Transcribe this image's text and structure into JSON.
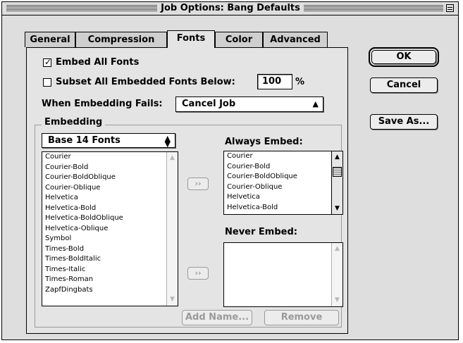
{
  "window": {
    "title": "Job Options: Bang Defaults"
  },
  "icons": {
    "zoom": "zoom-box-icon",
    "checkmark": "check-icon",
    "popup_arrows": "up-down-arrows-icon",
    "move": "move-right-icon"
  },
  "tabs": [
    {
      "label": "General",
      "active": false
    },
    {
      "label": "Compression",
      "active": false
    },
    {
      "label": "Fonts",
      "active": true
    },
    {
      "label": "Color",
      "active": false
    },
    {
      "label": "Advanced",
      "active": false
    }
  ],
  "fonts": {
    "embed_all_label": "Embed All Fonts",
    "embed_all_checked": true,
    "subset_label": "Subset All Embedded Fonts Below:",
    "subset_checked": false,
    "subset_value": "100",
    "subset_unit": "%",
    "when_fails_label": "When Embedding Fails:",
    "when_fails_value": "Cancel Job",
    "embedding_group_title": "Embedding",
    "source_popup_value": "Base 14 Fonts",
    "source_fonts": [
      "Courier",
      "Courier-Bold",
      "Courier-BoldOblique",
      "Courier-Oblique",
      "Helvetica",
      "Helvetica-Bold",
      "Helvetica-BoldOblique",
      "Helvetica-Oblique",
      "Symbol",
      "Times-Bold",
      "Times-BoldItalic",
      "Times-Italic",
      "Times-Roman",
      "ZapfDingbats"
    ],
    "always_embed_label": "Always Embed:",
    "always_embed_fonts": [
      "Courier",
      "Courier-Bold",
      "Courier-BoldOblique",
      "Courier-Oblique",
      "Helvetica",
      "Helvetica-Bold"
    ],
    "never_embed_label": "Never Embed:",
    "never_embed_fonts": [],
    "move_label": "››",
    "add_name_label": "Add Name...",
    "remove_label": "Remove"
  },
  "buttons": {
    "ok": "OK",
    "cancel": "Cancel",
    "save_as": "Save As..."
  }
}
